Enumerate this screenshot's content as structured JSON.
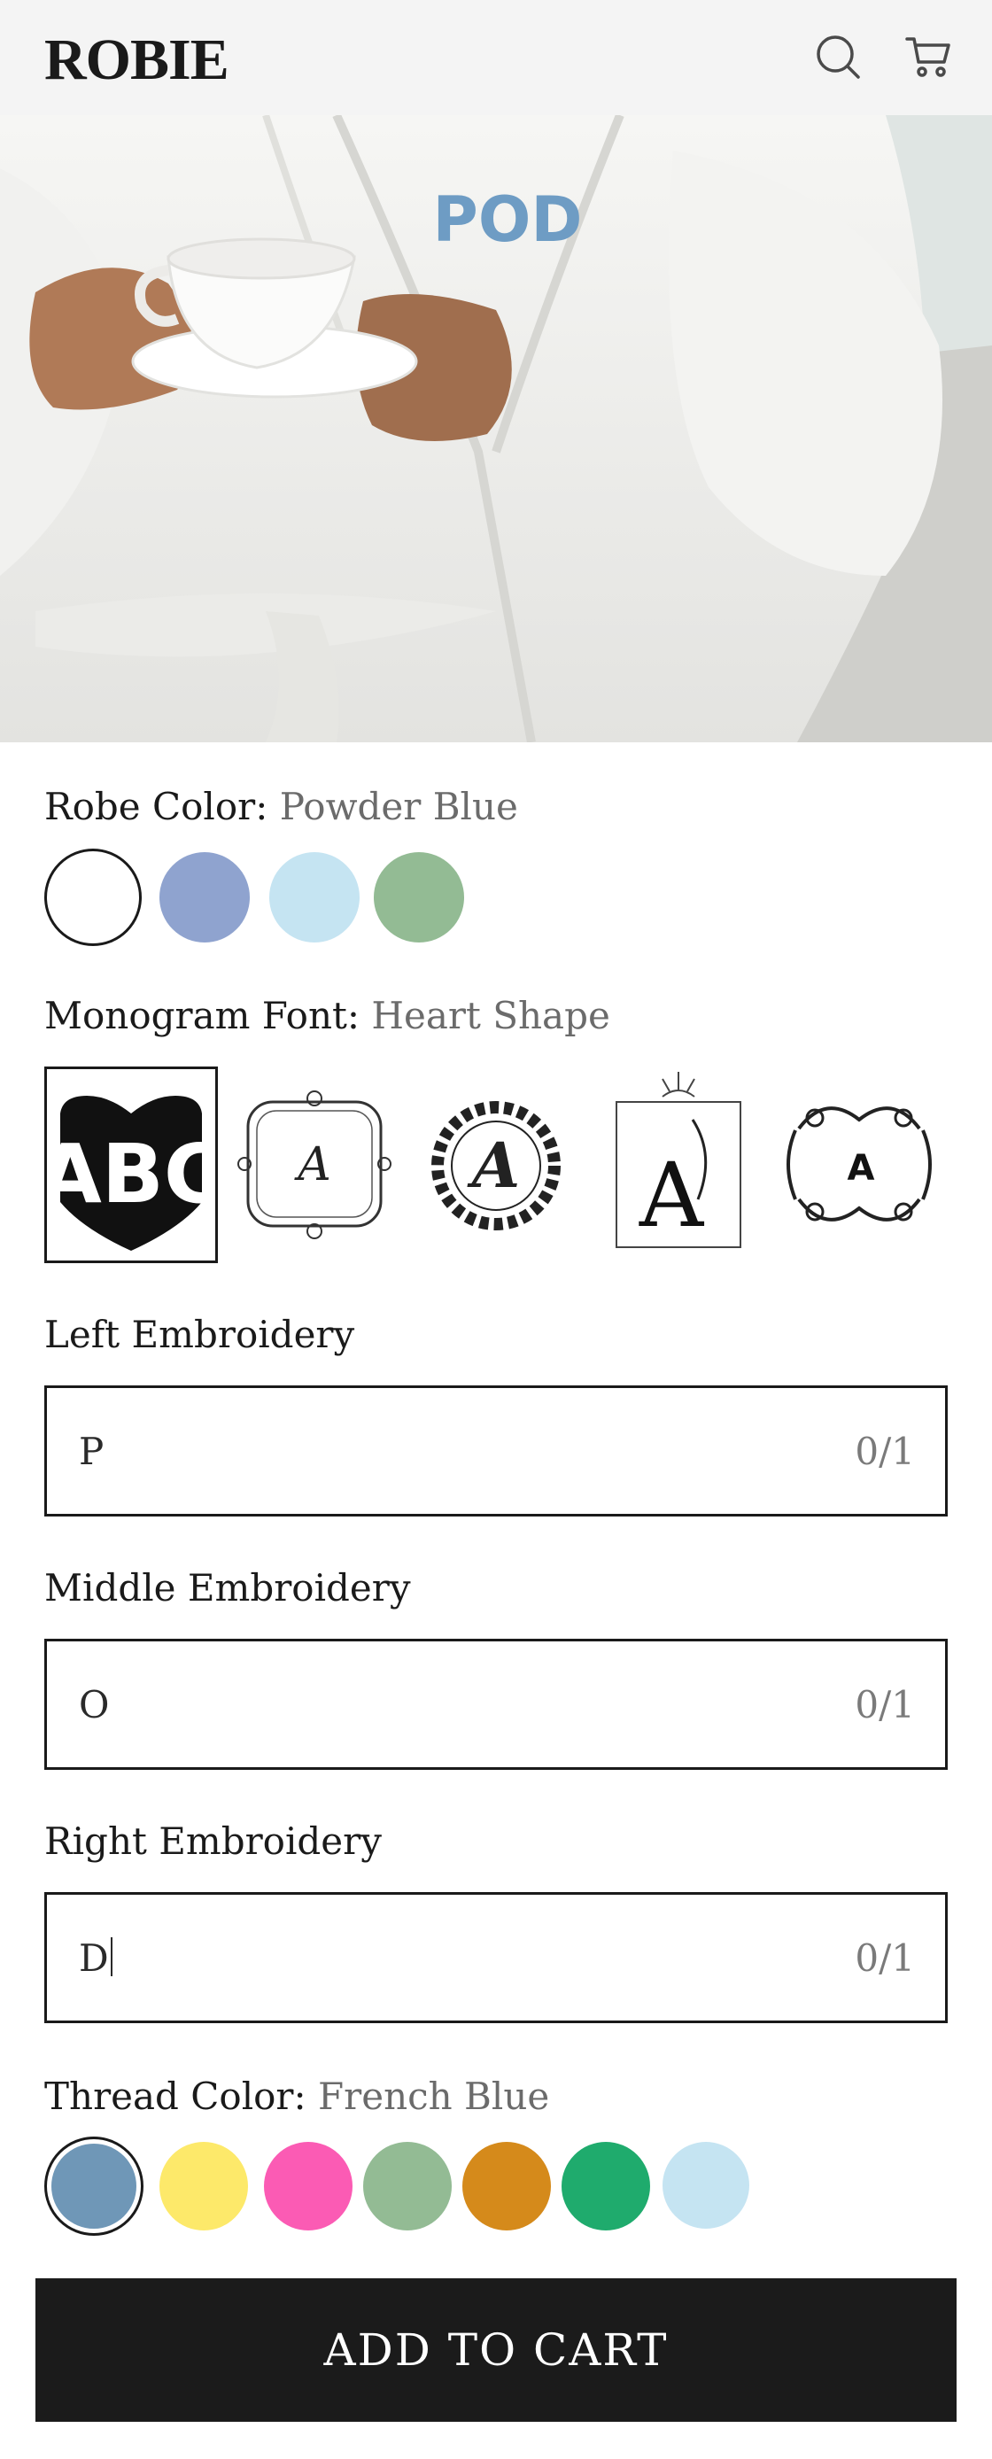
{
  "header": {
    "logo": "ROBIE",
    "icons": [
      "search-icon",
      "cart-icon"
    ]
  },
  "hero": {
    "monogram_text": "POD",
    "monogram_color": "#6e9cc4"
  },
  "robe_color": {
    "label": "Robe Color:",
    "selected": "Powder Blue",
    "swatches": [
      {
        "name": "White",
        "color": "#ffffff"
      },
      {
        "name": "Periwinkle",
        "color": "#8fa3cf"
      },
      {
        "name": "Powder Blue",
        "color": "#c5e4f2"
      },
      {
        "name": "Sage",
        "color": "#93bb94"
      }
    ]
  },
  "monogram_font": {
    "label": "Monogram Font:",
    "selected": "Heart Shape",
    "options": [
      {
        "id": "heart-shape",
        "preview": "ABC"
      },
      {
        "id": "framed-script",
        "preview": "A"
      },
      {
        "id": "wreath",
        "preview": "A"
      },
      {
        "id": "art-deco",
        "preview": "A"
      },
      {
        "id": "ornamental",
        "preview": "A"
      }
    ]
  },
  "embroidery": {
    "left": {
      "label": "Left Embroidery",
      "value": "P",
      "count": "0/1"
    },
    "middle": {
      "label": "Middle Embroidery",
      "value": "O",
      "count": "0/1"
    },
    "right": {
      "label": "Right Embroidery",
      "value": "D",
      "count": "0/1"
    }
  },
  "thread_color": {
    "label": "Thread Color:",
    "selected": "French Blue",
    "swatches": [
      {
        "name": "French Blue",
        "color": "#6f97b7"
      },
      {
        "name": "Yellow",
        "color": "#fde96a"
      },
      {
        "name": "Pink",
        "color": "#fb5bb4"
      },
      {
        "name": "Sage",
        "color": "#93bb94"
      },
      {
        "name": "Gold",
        "color": "#d58a1b"
      },
      {
        "name": "Kelly Green",
        "color": "#1fab6d"
      },
      {
        "name": "Light Blue",
        "color": "#c5e4f2"
      }
    ]
  },
  "cart": {
    "button_label": "ADD TO CART"
  }
}
